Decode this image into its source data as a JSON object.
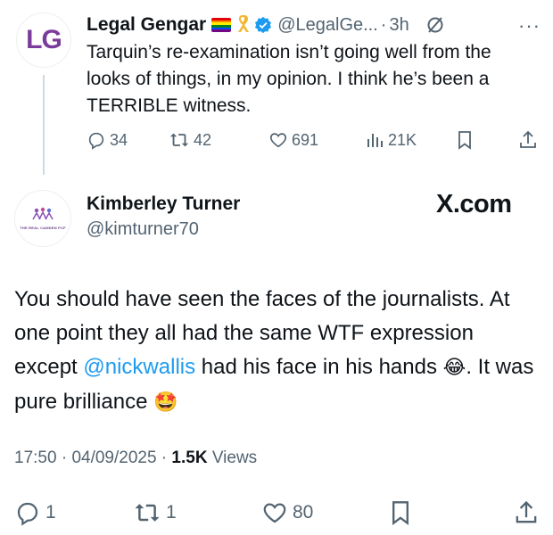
{
  "parent_tweet": {
    "avatar_text": "LG",
    "name": "Legal Gengar",
    "handle": "@LegalGe...",
    "separator": "·",
    "time": "3h",
    "more": "···",
    "text": "Tarquin’s re-examination isn’t going well from the looks of things, in my opinion. I think he’s been a TERRIBLE witness.",
    "actions": {
      "replies": "34",
      "reposts": "42",
      "likes": "691",
      "views": "21K"
    }
  },
  "main_tweet": {
    "avatar_text": "THE REAL CAMDEN PCF",
    "name": "Kimberley Turner",
    "handle": "@kimturner70",
    "watermark": "X.com",
    "text_part1": "You should have seen the faces of the journalists. At one point they all had the same WTF expression except ",
    "mention": "@nickwallis",
    "text_part2": " had his face in his hands ",
    "emoji1": "😂",
    "text_part3": ". It was pure brilliance ",
    "emoji2": "🤩",
    "meta": {
      "time": "17:50",
      "sep1": " · ",
      "date": "04/09/2025",
      "sep2": " · ",
      "views_count": "1.5K",
      "views_label": " Views"
    },
    "actions": {
      "replies": "1",
      "reposts": "1",
      "likes": "80"
    }
  },
  "colors": {
    "text": "#0f1419",
    "secondary": "#536471",
    "link": "#1d9bf0",
    "verified": "#1d9bf0",
    "thread_line": "#cfd9de"
  }
}
